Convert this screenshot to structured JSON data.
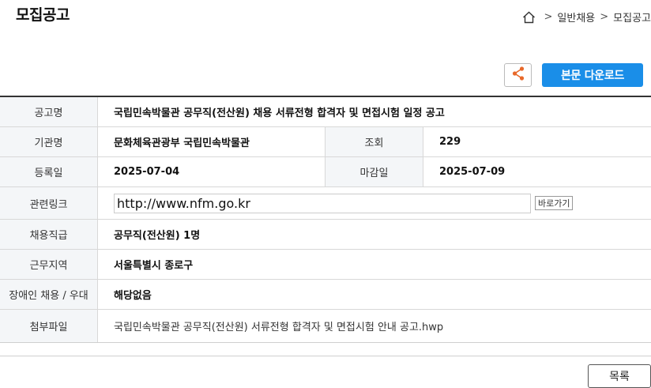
{
  "header": {
    "title": "모집공고",
    "breadcrumb": [
      ">",
      "일반채용",
      ">",
      "모집공고"
    ]
  },
  "actions": {
    "share_icon": "share-icon",
    "download_label": "본문 다운로드"
  },
  "table": {
    "title_label": "공고명",
    "title_value": "국립민속박물관 공무직(전산원) 채용 서류전형 합격자 및 면접시험 일정 공고",
    "agency_label": "기관명",
    "agency_value": "문화체육관광부 국립민속박물관",
    "views_label": "조회",
    "views_value": "229",
    "reg_label": "등록일",
    "reg_value": "2025-07-04",
    "deadline_label": "마감일",
    "deadline_value": "2025-07-09",
    "link_label": "관련링크",
    "link_value": "http://www.nfm.go.kr",
    "link_button": "바로가기",
    "grade_label": "채용직급",
    "grade_value": "공무직(전산원) 1명",
    "region_label": "근무지역",
    "region_value": "서울특별시 종로구",
    "disabled_label": "장애인 채용 / 우대",
    "disabled_value": "해당없음",
    "attach_label": "첨부파일",
    "attach_value": "국립민속박물관 공무직(전산원) 서류전형 합격자 및 면접시험 안내 공고.hwp"
  },
  "footer": {
    "list_label": "목록"
  },
  "colors": {
    "accent": "#1a8ee8",
    "share_icon": "#e8692a"
  }
}
